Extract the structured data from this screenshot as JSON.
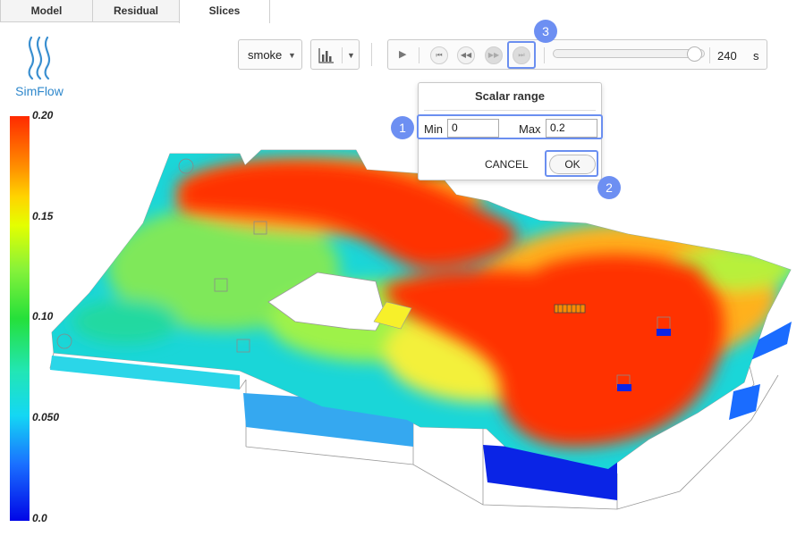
{
  "tabs": [
    {
      "label": "Model"
    },
    {
      "label": "Residual"
    },
    {
      "label": "Slices"
    }
  ],
  "logo": {
    "text": "SimFlow"
  },
  "toolbar": {
    "field_select": "smoke",
    "time_value": "240",
    "time_unit": "s"
  },
  "dialog": {
    "title": "Scalar range",
    "min_label": "Min",
    "min_value": "0",
    "max_label": "Max",
    "max_value": "0.2",
    "cancel_label": "CANCEL",
    "ok_label": "OK"
  },
  "badges": [
    "1",
    "2",
    "3"
  ],
  "colorbar": {
    "ticks": [
      "0.20",
      "0.15",
      "0.10",
      "0.050",
      "0.0"
    ]
  },
  "colors": {
    "accent": "#6d8ff2",
    "brand": "#2f88cc",
    "plume_high": "#ff3000",
    "plume_low": "#0010e6"
  }
}
